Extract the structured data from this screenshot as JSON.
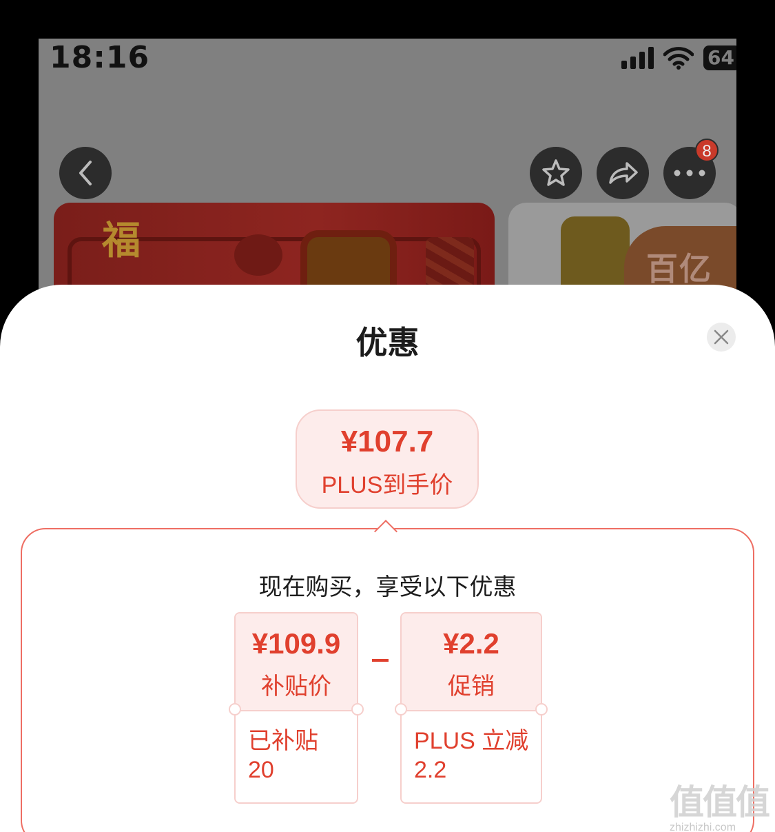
{
  "status_bar": {
    "time": "18:16",
    "battery": "64"
  },
  "nav": {
    "more_badge": "8"
  },
  "banner": {
    "brand_mark": "福",
    "side_tag": "百亿"
  },
  "sheet": {
    "title": "优惠",
    "final_price": {
      "amount": "¥107.7",
      "label": "PLUS到手价"
    },
    "heading": "现在购买，享受以下优惠",
    "cards": [
      {
        "amount": "¥109.9",
        "label": "补贴价",
        "detail_line1": "已补贴",
        "detail_line2": "20"
      },
      {
        "amount": "¥2.2",
        "label": "促销",
        "detail_line1": "PLUS 立减",
        "detail_line2": "2.2"
      }
    ],
    "operator": "−"
  },
  "watermark": {
    "glyphs": "值值值",
    "url": "zhizhizhi.com"
  },
  "colors": {
    "accent": "#e0402e",
    "accent_bg": "#fdeceb",
    "border": "#ee6e63"
  }
}
